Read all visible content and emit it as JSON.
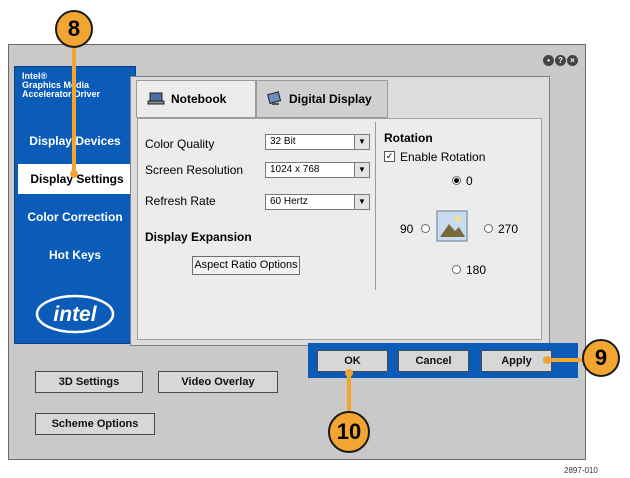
{
  "sidebar": {
    "brand_line1": "Intel®",
    "brand_line2": "Graphics Media",
    "brand_line3": "Accelerator Driver",
    "items": [
      {
        "label": "Display Devices"
      },
      {
        "label": "Display Settings",
        "active": true
      },
      {
        "label": "Color Correction"
      },
      {
        "label": "Hot Keys"
      }
    ],
    "logo_text": "intel"
  },
  "tabs": [
    {
      "label": "Notebook",
      "active": true
    },
    {
      "label": "Digital Display"
    }
  ],
  "settings": {
    "color_quality": {
      "label": "Color Quality",
      "value": "32 Bit"
    },
    "screen_resolution": {
      "label": "Screen Resolution",
      "value": "1024 x 768"
    },
    "refresh_rate": {
      "label": "Refresh Rate",
      "value": "60 Hertz"
    },
    "display_expansion": "Display Expansion",
    "aspect_ratio_button": "Aspect Ratio Options"
  },
  "rotation": {
    "title": "Rotation",
    "enable_label": "Enable Rotation",
    "enabled": true,
    "options": {
      "r0": "0",
      "r90": "90",
      "r180": "180",
      "r270": "270"
    },
    "selected": "0"
  },
  "buttons": {
    "ok": "OK",
    "cancel": "Cancel",
    "apply": "Apply",
    "settings_3d": "3D Settings",
    "video_overlay": "Video Overlay",
    "scheme_options": "Scheme Options"
  },
  "callouts": {
    "c8": "8",
    "c9": "9",
    "c10": "10"
  },
  "figure_id": "2897-010",
  "colors": {
    "sidebar_blue": "#0a5cb8",
    "callout_orange": "#f2a531"
  }
}
